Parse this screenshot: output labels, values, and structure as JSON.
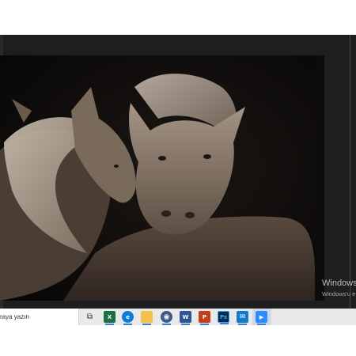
{
  "taskbar": {
    "search_placeholder": "raya yazın",
    "icons": [
      {
        "name": "task-view-icon",
        "glyph": "⧉"
      },
      {
        "name": "excel-icon",
        "glyph": "X"
      },
      {
        "name": "edge-icon",
        "glyph": "e"
      },
      {
        "name": "file-explorer-icon",
        "glyph": ""
      },
      {
        "name": "browser-icon",
        "glyph": "◉"
      },
      {
        "name": "word-icon",
        "glyph": "W"
      },
      {
        "name": "powerpoint-icon",
        "glyph": "P"
      },
      {
        "name": "photoshop-icon",
        "glyph": "Ps"
      },
      {
        "name": "mail-icon",
        "glyph": "✉"
      },
      {
        "name": "zoom-icon",
        "glyph": "▶"
      }
    ]
  },
  "watermark": {
    "title": "Windows'",
    "subtitle": "Windows'u e"
  },
  "colors": {
    "viewer_bg": "#1e1e1e",
    "taskbar_bg": "#e9e9e9",
    "excel": "#1d6f42",
    "edge": "#0f7bd8",
    "explorer": "#f2c14e",
    "word": "#2b5797",
    "powerpoint": "#c43e1c",
    "photoshop": "#0c2a47",
    "mail": "#1479c9",
    "zoom": "#2d8cff"
  }
}
